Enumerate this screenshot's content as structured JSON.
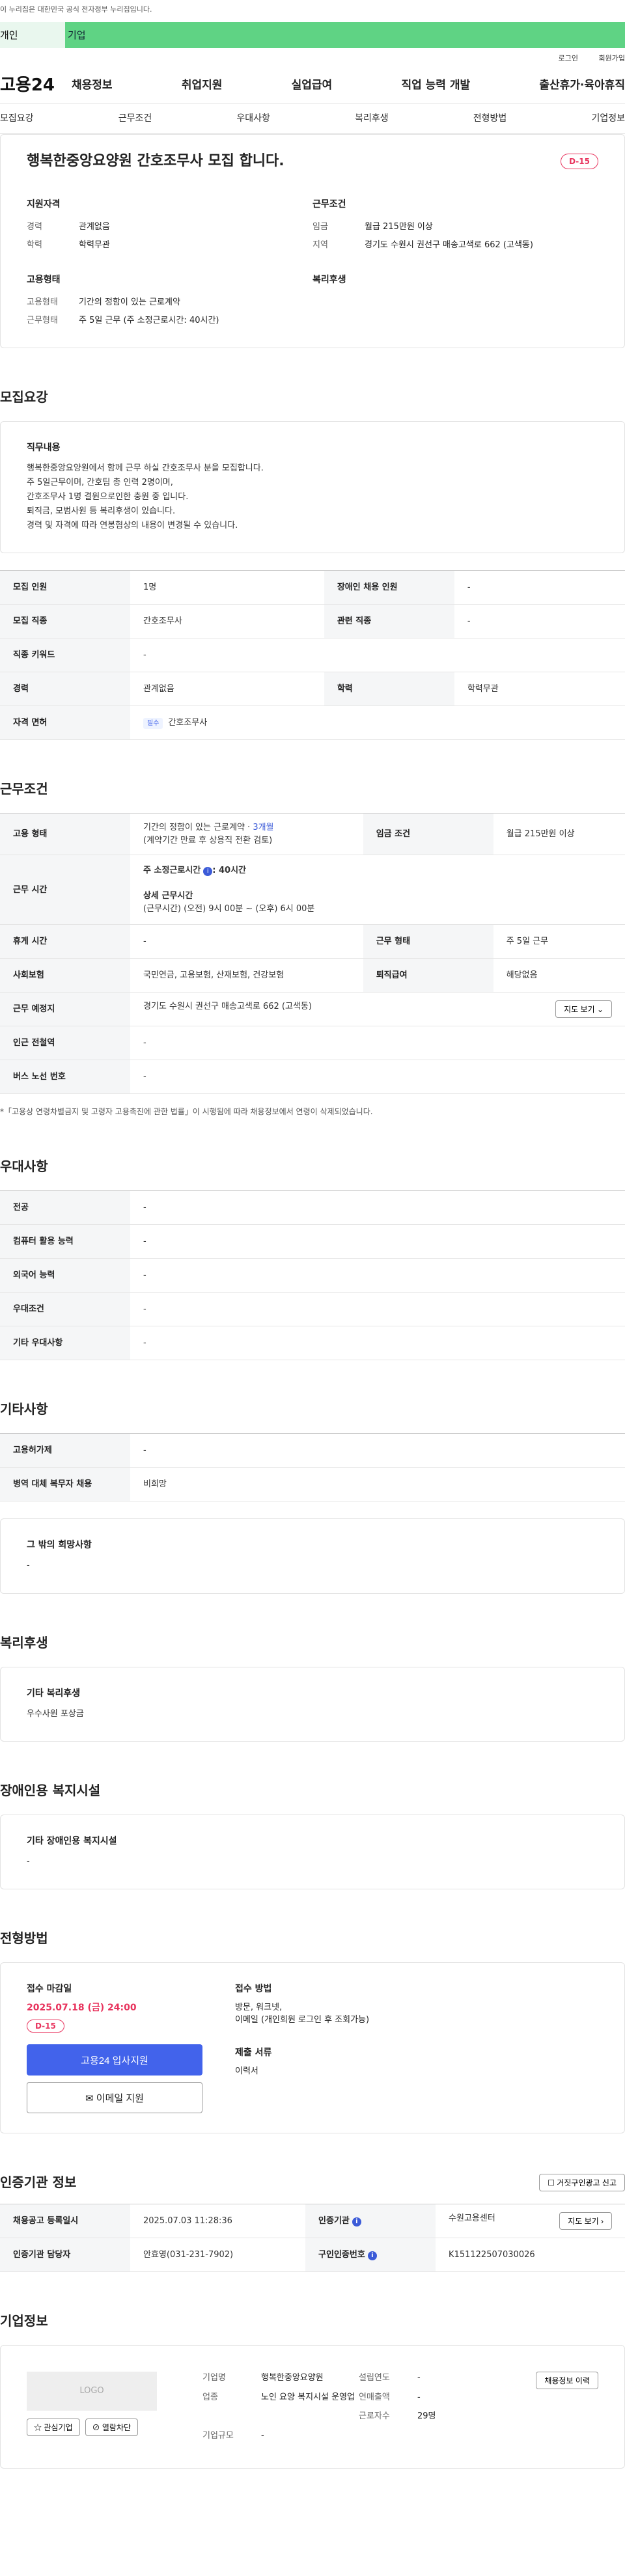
{
  "gov_notice": "이 누리집은 대한민국 공식 전자정부 누리집입니다.",
  "top_tabs": [
    "개인",
    "기업"
  ],
  "util_links": [
    "로그인",
    "회원가입"
  ],
  "brand": "고용24",
  "gnb": [
    "채용정보",
    "취업지원",
    "실업급여",
    "직업 능력 개발",
    "출산휴가·육아휴직"
  ],
  "subnav": [
    "모집요강",
    "근무조건",
    "우대사항",
    "복리후생",
    "전형방법",
    "기업정보"
  ],
  "header": {
    "title": "행복한중앙요양원 간호조무사 모집 합니다.",
    "dday": "D-15",
    "qual_title": "지원자격",
    "qual": [
      {
        "k": "경력",
        "v": "관계없음"
      },
      {
        "k": "학력",
        "v": "학력무관"
      }
    ],
    "cond_title": "근무조건",
    "cond": [
      {
        "k": "임금",
        "v": "월급 215만원 이상"
      },
      {
        "k": "지역",
        "v": "경기도 수원시 권선구 매송고색로 662 (고색동)"
      }
    ],
    "emp_title": "고용형태",
    "emp": [
      {
        "k": "고용형태",
        "v": "기간의 정함이 있는 근로계약"
      },
      {
        "k": "근무형태",
        "v": "주 5일 근무 (주 소정근로시간: 40시간)"
      }
    ],
    "welfare_title": "복리후생"
  },
  "recruit": {
    "section": "모집요강",
    "duty_title": "직무내용",
    "duty_lines": [
      "행복한중앙요양원에서 함께 근무 하실 간호조무사 분을 모집합니다.",
      "주 5일근무이며, 간호팀 총 인력 2명이며,",
      "간호조무사 1명 결원으로인한 충원 중 입니다.",
      "퇴직금, 모범사원 등 복리후생이 있습니다.",
      "경력 및 자격에 따라 연봉협상의 내용이 변경될 수 있습니다."
    ],
    "rows": {
      "headcount_k": "모집 인원",
      "headcount_v": "1명",
      "disabled_k": "장애인 채용 인원",
      "disabled_v": "-",
      "job_k": "모집 직종",
      "job_v": "간호조무사",
      "related_k": "관련 직종",
      "related_v": "-",
      "keyword_k": "직종 키워드",
      "keyword_v": "-",
      "career_k": "경력",
      "career_v": "관계없음",
      "edu_k": "학력",
      "edu_v": "학력무관",
      "license_k": "자격 면허",
      "license_tag": "필수",
      "license_v": "간호조무사"
    }
  },
  "work": {
    "section": "근무조건",
    "emp_k": "고용 형태",
    "emp_v1": "기간의 정함이 있는 근로계약 · ",
    "emp_v1b": "3개월",
    "emp_v2": "(계약기간 만료 후 상용직 전환 검토)",
    "wage_k": "임금 조건",
    "wage_v": "월급 215만원 이상",
    "hours_k": "근무 시간",
    "hours_std": "주 소정근로시간",
    "hours_std_v": ": 40시간",
    "hours_detail_t": "상세 근무시간",
    "hours_detail_v": "(근무시간) (오전) 9시 00분 ~ (오후) 6시 00분",
    "rest_k": "휴게 시간",
    "rest_v": "-",
    "form_k": "근무 형태",
    "form_v": "주 5일 근무",
    "ins_k": "사회보험",
    "ins_v": "국민연금, 고용보험, 산재보험, 건강보험",
    "sev_k": "퇴직급여",
    "sev_v": "해당없음",
    "place_k": "근무 예정지",
    "place_v": "경기도 수원시 권선구 매송고색로 662 (고색동)",
    "map_btn": "지도 보기",
    "station_k": "인근 전철역",
    "station_v": "-",
    "bus_k": "버스 노선 번호",
    "bus_v": "-",
    "note": "*「고용상 연령차별금지 및 고령자 고용촉진에 관한 법률」이 시행됨에 따라 채용정보에서 연령이 삭제되었습니다."
  },
  "pref": {
    "section": "우대사항",
    "rows": [
      {
        "k": "전공",
        "v": "-"
      },
      {
        "k": "컴퓨터 활용 능력",
        "v": "-"
      },
      {
        "k": "외국어 능력",
        "v": "-"
      },
      {
        "k": "우대조건",
        "v": "-"
      },
      {
        "k": "기타 우대사항",
        "v": "-"
      }
    ]
  },
  "etc": {
    "section": "기타사항",
    "rows": [
      {
        "k": "고용허가제",
        "v": "-"
      },
      {
        "k": "병역 대체 복무자 채용",
        "v": "비희망"
      }
    ],
    "other_title": "그 밖의 희망사항",
    "other_v": "-"
  },
  "welfare": {
    "section": "복리후생",
    "title": "기타 복리후생",
    "v": "우수사원 포상금"
  },
  "disabled_fac": {
    "section": "장애인용 복지시설",
    "title": "기타 장애인용 복지시설",
    "v": "-"
  },
  "process": {
    "section": "전형방법",
    "deadline_t": "접수 마감일",
    "deadline_v": "2025.07.18 (금) 24:00",
    "dday": "D-15",
    "apply_btn": "고용24 입사지원",
    "email_btn": "이메일 지원",
    "method_t": "접수 방법",
    "method_v1": "방문, 워크넷,",
    "method_v2": "이메일 (개인회원 로그인 후 조회가능)",
    "docs_t": "제출 서류",
    "docs_v": "이력서"
  },
  "agency": {
    "section": "인증기관 정보",
    "report_btn": "거짓구인광고 신고",
    "reg_k": "채용공고 등록일시",
    "reg_v": "2025.07.03 11:28:36",
    "org_k": "인증기관",
    "org_v": "수원고용센터",
    "map_btn": "지도 보기",
    "mgr_k": "인증기관 담당자",
    "mgr_v": "안효영(031-231-7902)",
    "num_k": "구인인증번호",
    "num_v": "K151122507030026"
  },
  "company": {
    "section": "기업정보",
    "logo": "LOGO",
    "fav_btn": "관심기업",
    "block_btn": "열람차단",
    "name_k": "기업명",
    "name_v": "행복한중앙요양원",
    "year_k": "설립연도",
    "year_v": "-",
    "ind_k": "업종",
    "ind_v": "노인 요양 복지시설 운영업",
    "sales_k": "연매출액",
    "sales_v": "-",
    "emp_k": "근로자수",
    "emp_v": "29명",
    "size_k": "기업규모",
    "size_v": "-",
    "history_btn": "채용정보 이력"
  }
}
